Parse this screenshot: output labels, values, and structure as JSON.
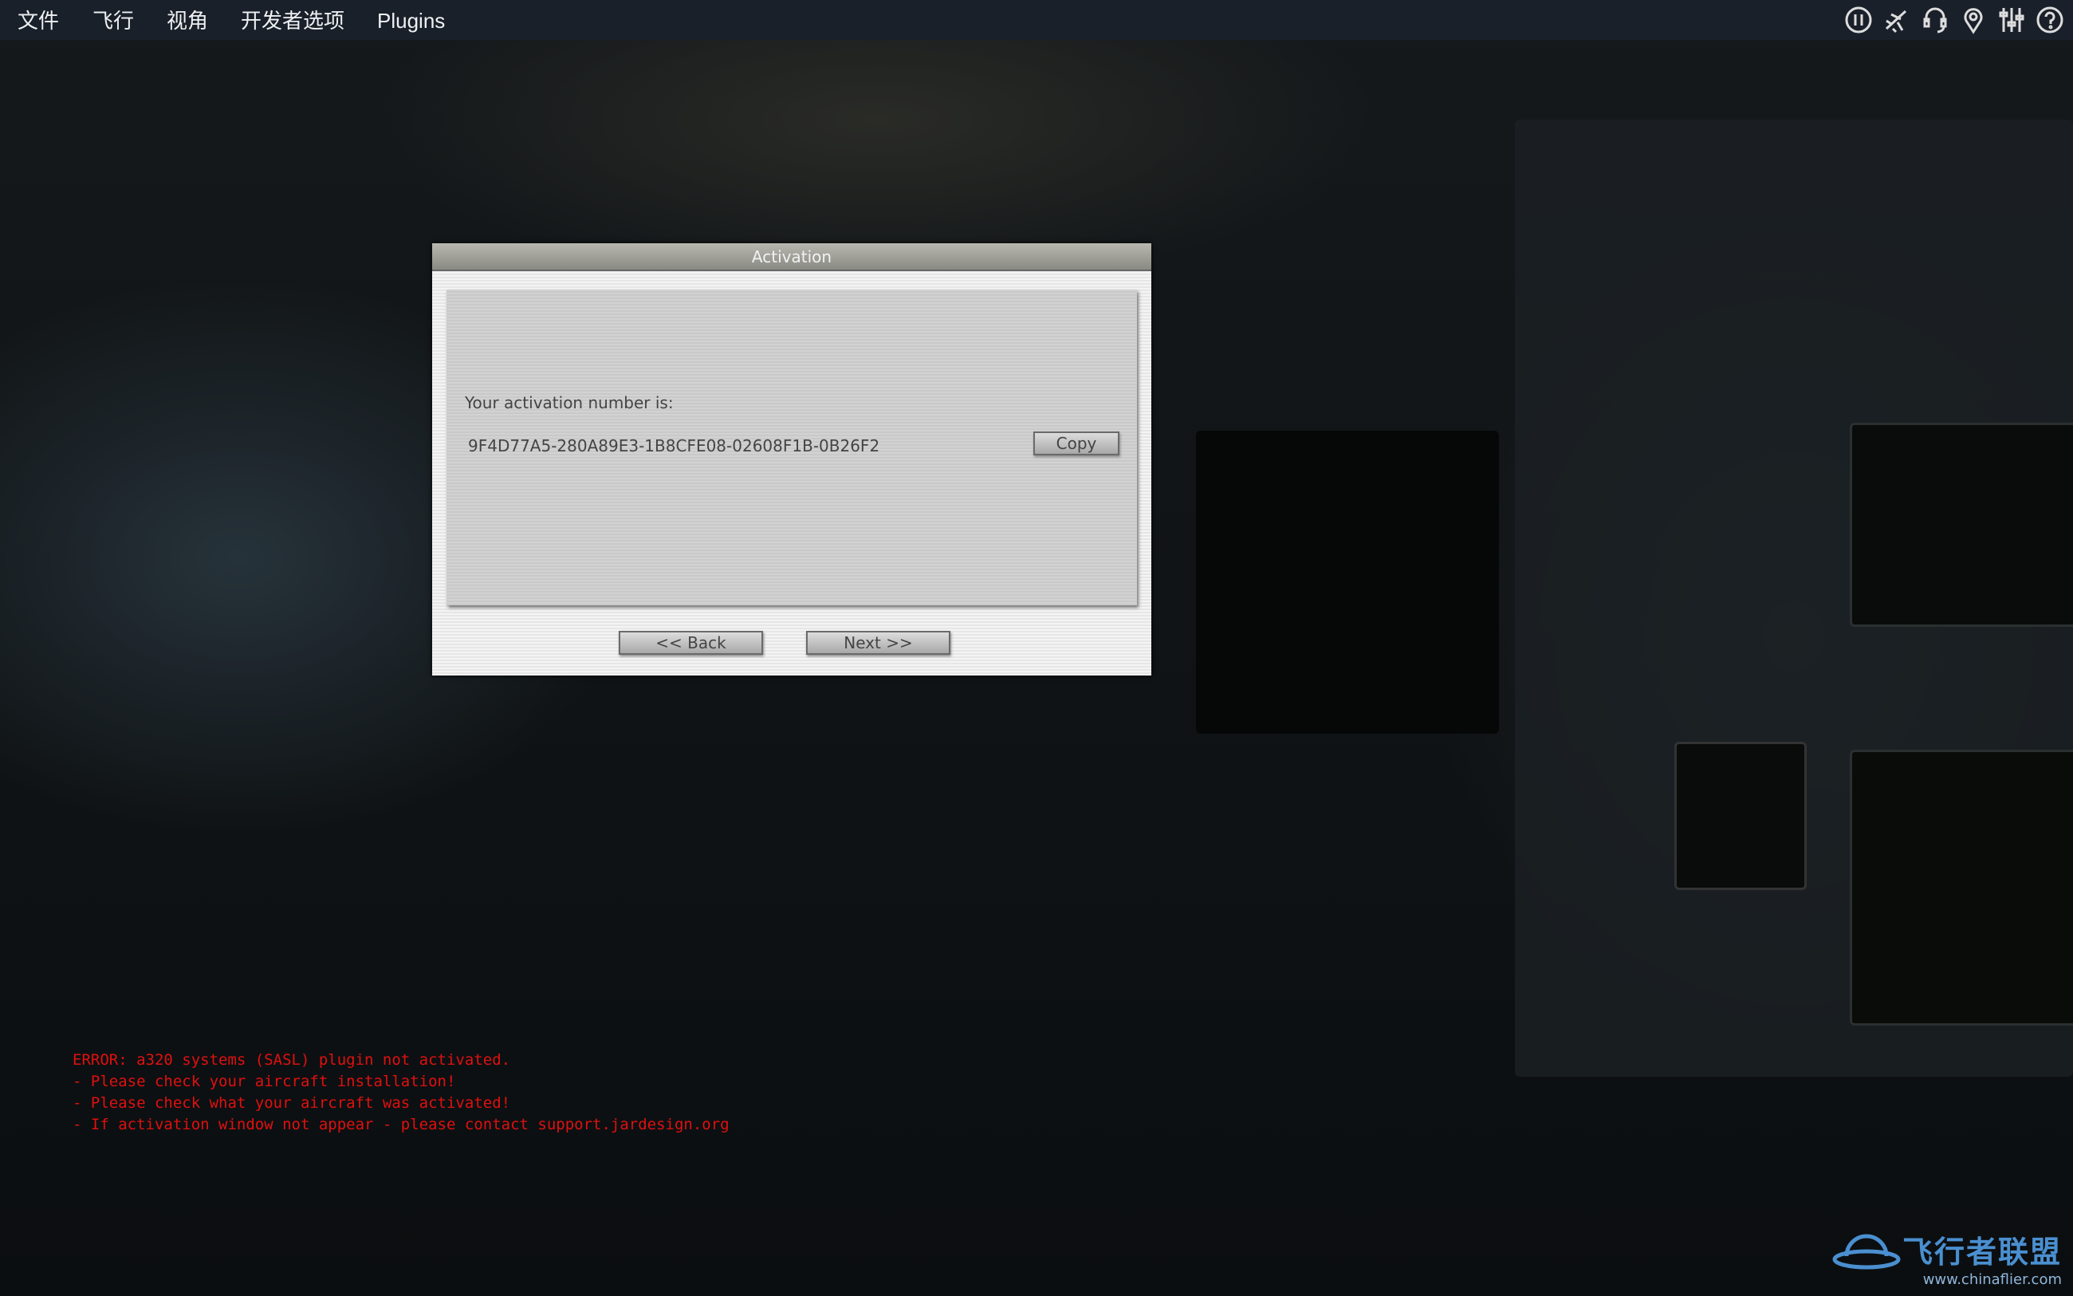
{
  "menubar": {
    "items": [
      "文件",
      "飞行",
      "视角",
      "开发者选项",
      "Plugins"
    ],
    "icons": [
      "pause-icon",
      "airplane-icon",
      "headset-icon",
      "map-pin-icon",
      "sliders-icon",
      "help-icon"
    ]
  },
  "dialog": {
    "title": "Activation",
    "prompt": "Your activation number is:",
    "activation_number": "9F4D77A5-280A89E3-1B8CFE08-02608F1B-0B26F2",
    "copy_label": "Copy",
    "back_label": "<< Back",
    "next_label": "Next >>"
  },
  "errors": [
    "ERROR: a320 systems (SASL) plugin not activated.",
    "- Please check your aircraft installation!",
    "- Please check what your aircraft was activated!",
    "- If activation window not appear - please contact support.jardesign.org"
  ],
  "watermark": {
    "name": "飞行者联盟",
    "url": "www.chinaflier.com"
  },
  "colors": {
    "error": "#e0100f",
    "menubar": "#1a202a",
    "watermark": "#4a8fd0"
  }
}
